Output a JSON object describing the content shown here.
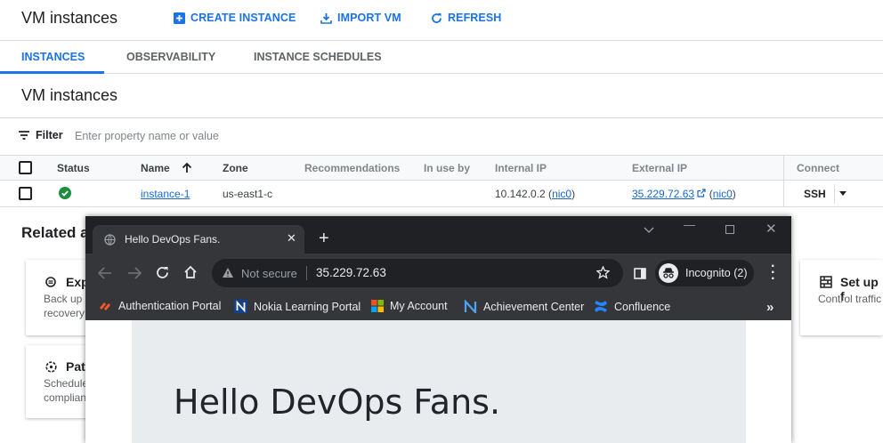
{
  "header": {
    "title": "VM instances",
    "create_label": "CREATE INSTANCE",
    "import_label": "IMPORT VM",
    "refresh_label": "REFRESH"
  },
  "tabs": [
    {
      "label": "INSTANCES",
      "active": true
    },
    {
      "label": "OBSERVABILITY",
      "active": false
    },
    {
      "label": "INSTANCE SCHEDULES",
      "active": false
    }
  ],
  "section_title": "VM instances",
  "filter": {
    "label": "Filter",
    "placeholder": "Enter property name or value"
  },
  "table": {
    "headers": [
      "Status",
      "Name",
      "Zone",
      "Recommendations",
      "In use by",
      "Internal IP",
      "External IP",
      "Connect"
    ],
    "rows": [
      {
        "name": "instance-1",
        "zone": "us-east1-c",
        "internal_ip": "10.142.0.2",
        "internal_nic": "nic0",
        "external_ip": "35.229.72.63",
        "external_nic": "nic0",
        "connect": "SSH",
        "status_icon": "check-circle-icon",
        "status_color": "#1e8e3e"
      }
    ]
  },
  "related": {
    "title": "Related a",
    "cards": [
      {
        "title": "Exp",
        "text1": "Back up y",
        "text2": "recovery"
      },
      {
        "title": "Pat",
        "text1": "Schedule",
        "text2": "complian"
      },
      {
        "title": "Set up f",
        "text1": "Control traffic"
      }
    ]
  },
  "browser": {
    "tab_title": "Hello DevOps Fans.",
    "not_secure": "Not secure",
    "url": "35.229.72.63",
    "incognito": "Incognito (2)",
    "bookmarks": [
      {
        "label": "Authentication Portal",
        "icon": "palo-alto-icon"
      },
      {
        "label": "Nokia Learning Portal",
        "icon": "n-logo-icon"
      },
      {
        "label": "My Account",
        "icon": "microsoft-icon"
      },
      {
        "label": "Achievement Center",
        "icon": "n-logo-icon"
      },
      {
        "label": "Confluence",
        "icon": "confluence-icon"
      }
    ],
    "more": "»",
    "page_heading": "Hello DevOps Fans."
  },
  "colors": {
    "accent": "#1a73e8",
    "browser_frame": "#202124",
    "browser_toolbar": "#35363a"
  }
}
